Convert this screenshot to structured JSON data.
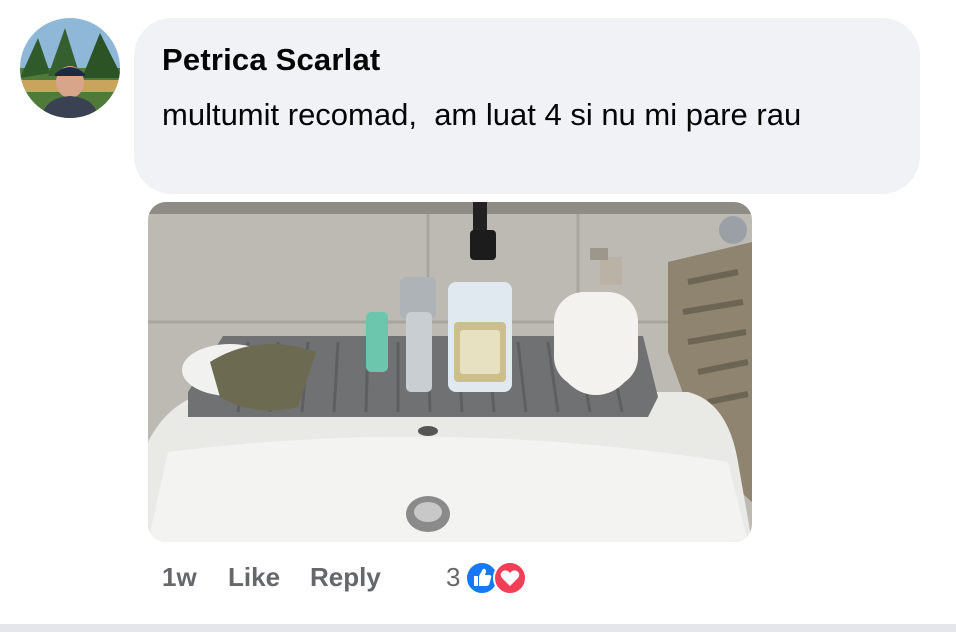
{
  "comment": {
    "author": "Petrica Scarlat",
    "text": "multumit recomad,  am luat 4 si nu mi pare rau",
    "avatar_icon": "user-avatar",
    "photo_icon": "bathroom-sink-photo"
  },
  "actions": {
    "time": "1w",
    "like_label": "Like",
    "reply_label": "Reply",
    "reaction_count": "3",
    "reactions": [
      "like-reaction-icon",
      "love-reaction-icon"
    ]
  },
  "colors": {
    "bubble": "#f0f2f5",
    "text": "#050505",
    "meta": "#65676b",
    "like_blue": "#1877f2",
    "love_red": "#f33e58"
  }
}
